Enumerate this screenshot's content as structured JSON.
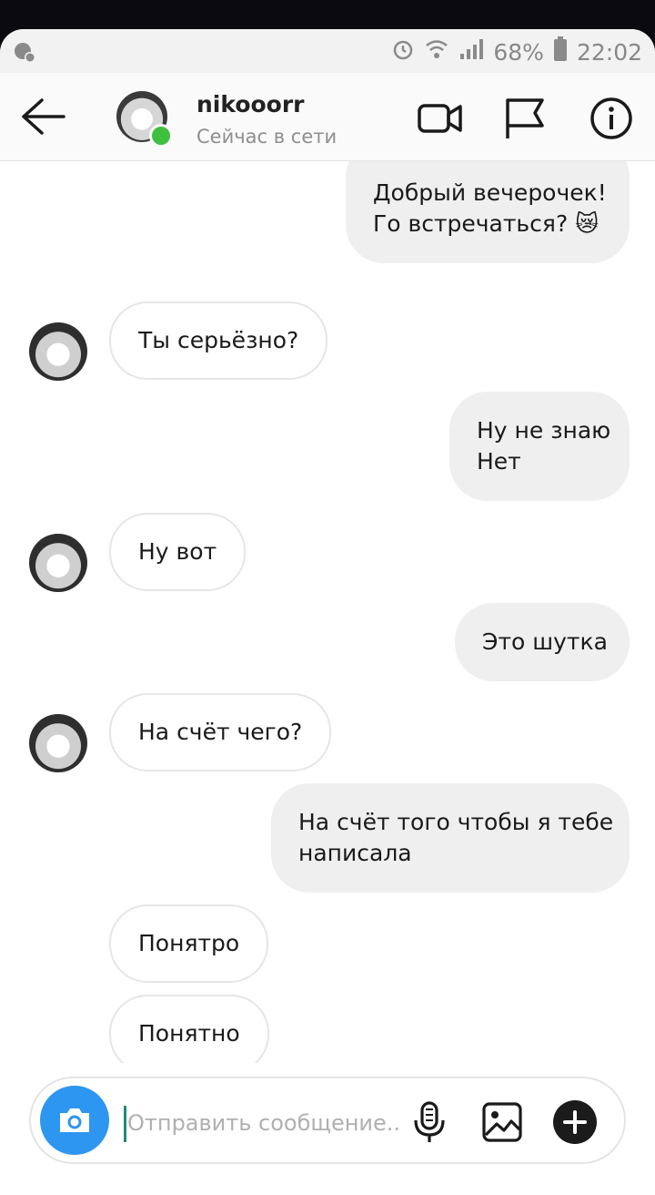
{
  "status_bar": {
    "battery": "68%",
    "time": "22:02"
  },
  "header": {
    "username": "nikooorr",
    "presence": "Сейчас в сети"
  },
  "messages": [
    {
      "side": "out",
      "lines": [
        "Добрый вечерочек!",
        "Го встречаться? 😿"
      ]
    },
    {
      "side": "in",
      "lines": [
        "Ты серьёзно?"
      ]
    },
    {
      "side": "out",
      "lines": [
        "Ну не знаю",
        "Нет"
      ]
    },
    {
      "side": "in",
      "lines": [
        "Ну вот"
      ]
    },
    {
      "side": "out",
      "lines": [
        "Это шутка"
      ]
    },
    {
      "side": "in",
      "lines": [
        "На счёт чего?"
      ]
    },
    {
      "side": "out",
      "lines": [
        "На счёт того чтобы я тебе",
        "написала"
      ]
    },
    {
      "side": "in",
      "lines": [
        "Понятро"
      ]
    },
    {
      "side": "in",
      "lines": [
        "Понятно"
      ]
    }
  ],
  "composer": {
    "placeholder": "Отправить сообщение..."
  },
  "colors": {
    "accent": "#2d96f0",
    "online": "#3fbf3f",
    "outgoing_bubble": "#efefef"
  }
}
